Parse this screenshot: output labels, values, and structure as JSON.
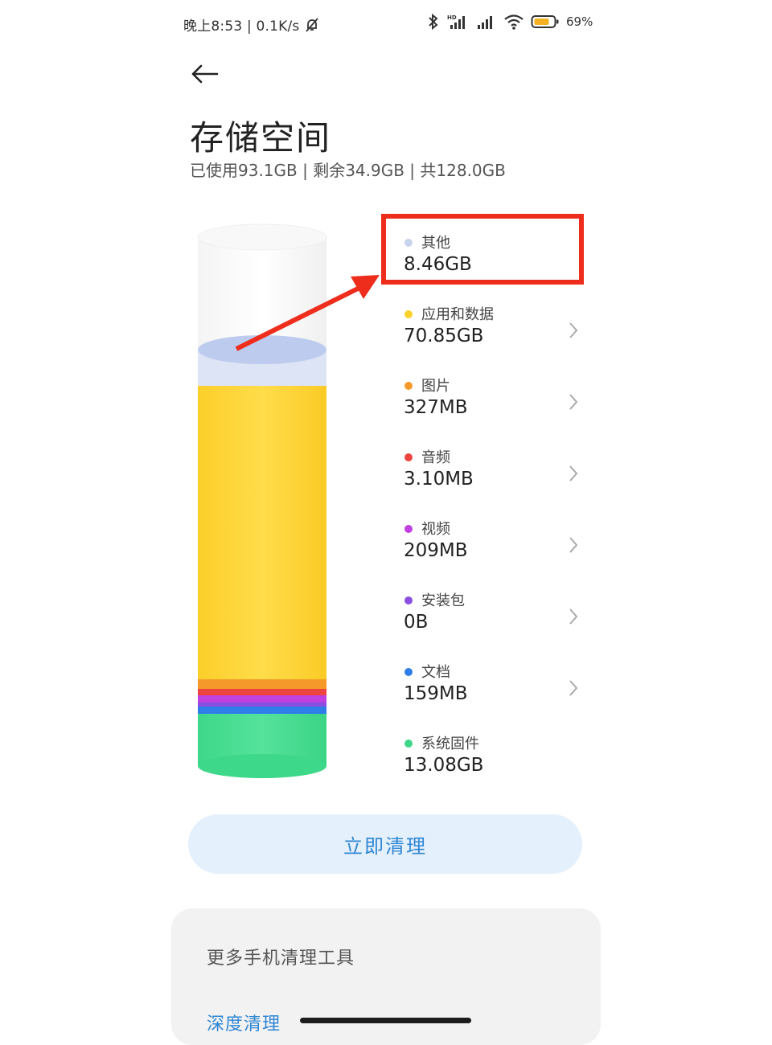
{
  "status_bar": {
    "time_speed": "晚上8:53 | 0.1K/s",
    "battery": "69%"
  },
  "page": {
    "title": "存储空间",
    "summary": "已使用93.1GB | 剩余34.9GB | 共128.0GB"
  },
  "categories": [
    {
      "name": "其他",
      "size": "8.46GB",
      "color": "#c8d3ee",
      "chevron": false
    },
    {
      "name": "应用和数据",
      "size": "70.85GB",
      "color": "#fbd22c",
      "chevron": true
    },
    {
      "name": "图片",
      "size": "327MB",
      "color": "#f59a2a",
      "chevron": true
    },
    {
      "name": "音频",
      "size": "3.10MB",
      "color": "#ee4440",
      "chevron": true
    },
    {
      "name": "视频",
      "size": "209MB",
      "color": "#c040e0",
      "chevron": true
    },
    {
      "name": "安装包",
      "size": "0B",
      "color": "#8a4fe0",
      "chevron": true
    },
    {
      "name": "文档",
      "size": "159MB",
      "color": "#2f7de8",
      "chevron": true
    },
    {
      "name": "系统固件",
      "size": "13.08GB",
      "color": "#3fd68a",
      "chevron": false
    }
  ],
  "actions": {
    "clean_now": "立即清理"
  },
  "tools": {
    "title": "更多手机清理工具",
    "deep_clean": "深度清理"
  },
  "colors": {
    "accent": "#2f86d4",
    "highlight": "#ef2d1c"
  }
}
